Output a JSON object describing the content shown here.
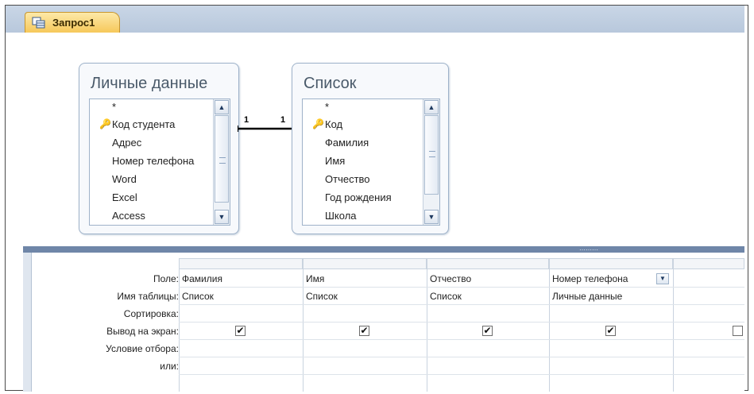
{
  "tab": {
    "label": "Запрос1",
    "icon": "query-icon"
  },
  "tables": [
    {
      "title": "Личные данные",
      "fields": [
        {
          "name": "*",
          "key": false
        },
        {
          "name": "Код студента",
          "key": true
        },
        {
          "name": "Адрес",
          "key": false
        },
        {
          "name": "Номер телефона",
          "key": false
        },
        {
          "name": "Word",
          "key": false
        },
        {
          "name": "Excel",
          "key": false
        },
        {
          "name": "Access",
          "key": false
        }
      ]
    },
    {
      "title": "Список",
      "fields": [
        {
          "name": "*",
          "key": false
        },
        {
          "name": "Код",
          "key": true
        },
        {
          "name": "Фамилия",
          "key": false
        },
        {
          "name": "Имя",
          "key": false
        },
        {
          "name": "Отчество",
          "key": false
        },
        {
          "name": "Год рождения",
          "key": false
        },
        {
          "name": "Школа",
          "key": false
        }
      ]
    }
  ],
  "relationship": {
    "left_label": "1",
    "right_label": "1"
  },
  "grid": {
    "row_labels": [
      "Поле:",
      "Имя таблицы:",
      "Сортировка:",
      "Вывод на экран:",
      "Условие отбора:",
      "или:"
    ],
    "columns": [
      {
        "field": "Фамилия",
        "table": "Список",
        "sort": "",
        "show": true
      },
      {
        "field": "Имя",
        "table": "Список",
        "sort": "",
        "show": true
      },
      {
        "field": "Отчество",
        "table": "Список",
        "sort": "",
        "show": true
      },
      {
        "field": "Номер телефона",
        "table": "Личные данные",
        "sort": "",
        "show": true
      },
      {
        "field": "",
        "table": "",
        "sort": "",
        "show": false
      }
    ]
  },
  "colors": {
    "splitter": "#6f86a8",
    "tab": "#f6c85a",
    "tabstrip": "#c9d6e6"
  }
}
